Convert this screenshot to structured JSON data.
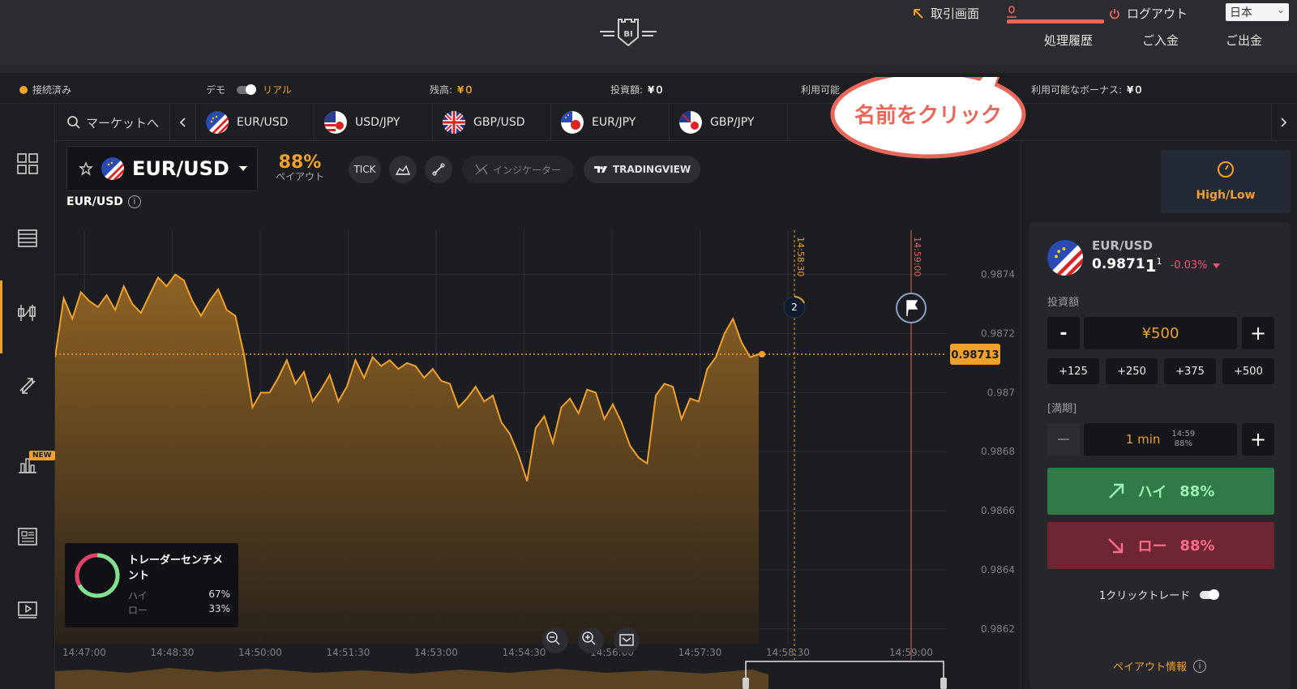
{
  "header": {
    "trade_screen": "取引画面",
    "logout": "ログアウト",
    "language": "日本",
    "history": "処理履歴",
    "deposit": "ご入金",
    "withdraw": "ご出金",
    "logo_text": "BI"
  },
  "status": {
    "connected": "接続済み",
    "demo": "デモ",
    "real": "リアル",
    "balance_label": "残高:",
    "balance_value": "¥０",
    "invested_label": "投資額:",
    "invested_value": "¥０",
    "available_label": "利用可能",
    "bonus_label": "利用可能なボーナス:",
    "bonus_value": "¥０"
  },
  "market_tabs": {
    "search": "マーケットへ",
    "items": [
      "EUR/USD",
      "USD/JPY",
      "GBP/USD",
      "EUR/JPY",
      "GBP/JPY"
    ]
  },
  "asset": {
    "name": "EUR/USD",
    "payout": "88%",
    "payout_label": "ペイアウト",
    "tick": "TICK",
    "indicator": "インジケーター",
    "tradingview": "TRADINGVIEW",
    "chart_label": "EUR/USD"
  },
  "chart_data": {
    "type": "area",
    "x_ticks": [
      "14:47:00",
      "14:48:30",
      "14:50:00",
      "14:51:30",
      "14:53:00",
      "14:54:30",
      "14:56:00",
      "14:57:30",
      "14:58:30",
      "14:59:00"
    ],
    "y_ticks": [
      "0.9874",
      "0.9872",
      "0.987",
      "0.9868",
      "0.9866",
      "0.9864",
      "0.9862"
    ],
    "ylim": [
      0.98615,
      0.98755
    ],
    "current_price": "0.98713",
    "current_value": 0.98713,
    "expiry_marker_label": "14:58:30",
    "end_marker_label": "14:59:00",
    "marker_count": "2",
    "values": [
      0.98712,
      0.98732,
      0.98725,
      0.98734,
      0.98731,
      0.98729,
      0.98733,
      0.98728,
      0.98736,
      0.9873,
      0.98727,
      0.98733,
      0.98739,
      0.98736,
      0.9874,
      0.98738,
      0.98731,
      0.98726,
      0.98731,
      0.98735,
      0.98728,
      0.98726,
      0.98713,
      0.98695,
      0.987,
      0.987,
      0.98705,
      0.98711,
      0.98703,
      0.98707,
      0.98697,
      0.98701,
      0.98706,
      0.98697,
      0.98702,
      0.98711,
      0.98705,
      0.98712,
      0.98709,
      0.98711,
      0.98708,
      0.9871,
      0.98709,
      0.98705,
      0.98708,
      0.98704,
      0.98703,
      0.98695,
      0.98698,
      0.98702,
      0.98697,
      0.98699,
      0.9869,
      0.98686,
      0.98679,
      0.9867,
      0.98688,
      0.98692,
      0.98683,
      0.98695,
      0.98698,
      0.98693,
      0.98701,
      0.987,
      0.98691,
      0.98696,
      0.9869,
      0.98682,
      0.98678,
      0.98676,
      0.98699,
      0.98703,
      0.98702,
      0.98691,
      0.98698,
      0.98697,
      0.98708,
      0.98712,
      0.9872,
      0.98725,
      0.98717,
      0.98712,
      0.98713
    ]
  },
  "sentiment": {
    "title": "トレーダーセンチメント",
    "high_label": "ハイ",
    "high_value": "67%",
    "low_label": "ロー",
    "low_value": "33%",
    "high_fraction": 0.67
  },
  "callout": {
    "text": "名前をクリック"
  },
  "trade_panel": {
    "tab_label": "High/Low",
    "asset": "EUR/USD",
    "price_main": "0.9871",
    "price_sup": "1",
    "price_last": "1",
    "change": "-0.03%",
    "invest_label": "投資額",
    "minus": "-",
    "plus": "+",
    "amount": "¥500",
    "quick_amounts": [
      "+125",
      "+250",
      "+375",
      "+500"
    ],
    "expiry_label": "[満期]",
    "expiry_value": "1 min",
    "expiry_time": "14:59",
    "expiry_payout": "88%",
    "high_label": "ハイ",
    "high_payout": "88%",
    "low_label": "ロー",
    "low_payout": "88%",
    "one_click": "1クリックトレード",
    "payout_info": "ペイアウト情報",
    "colors": {
      "accent": "#f0a12b",
      "high": "#2f7a47",
      "low": "#6e2633"
    }
  }
}
